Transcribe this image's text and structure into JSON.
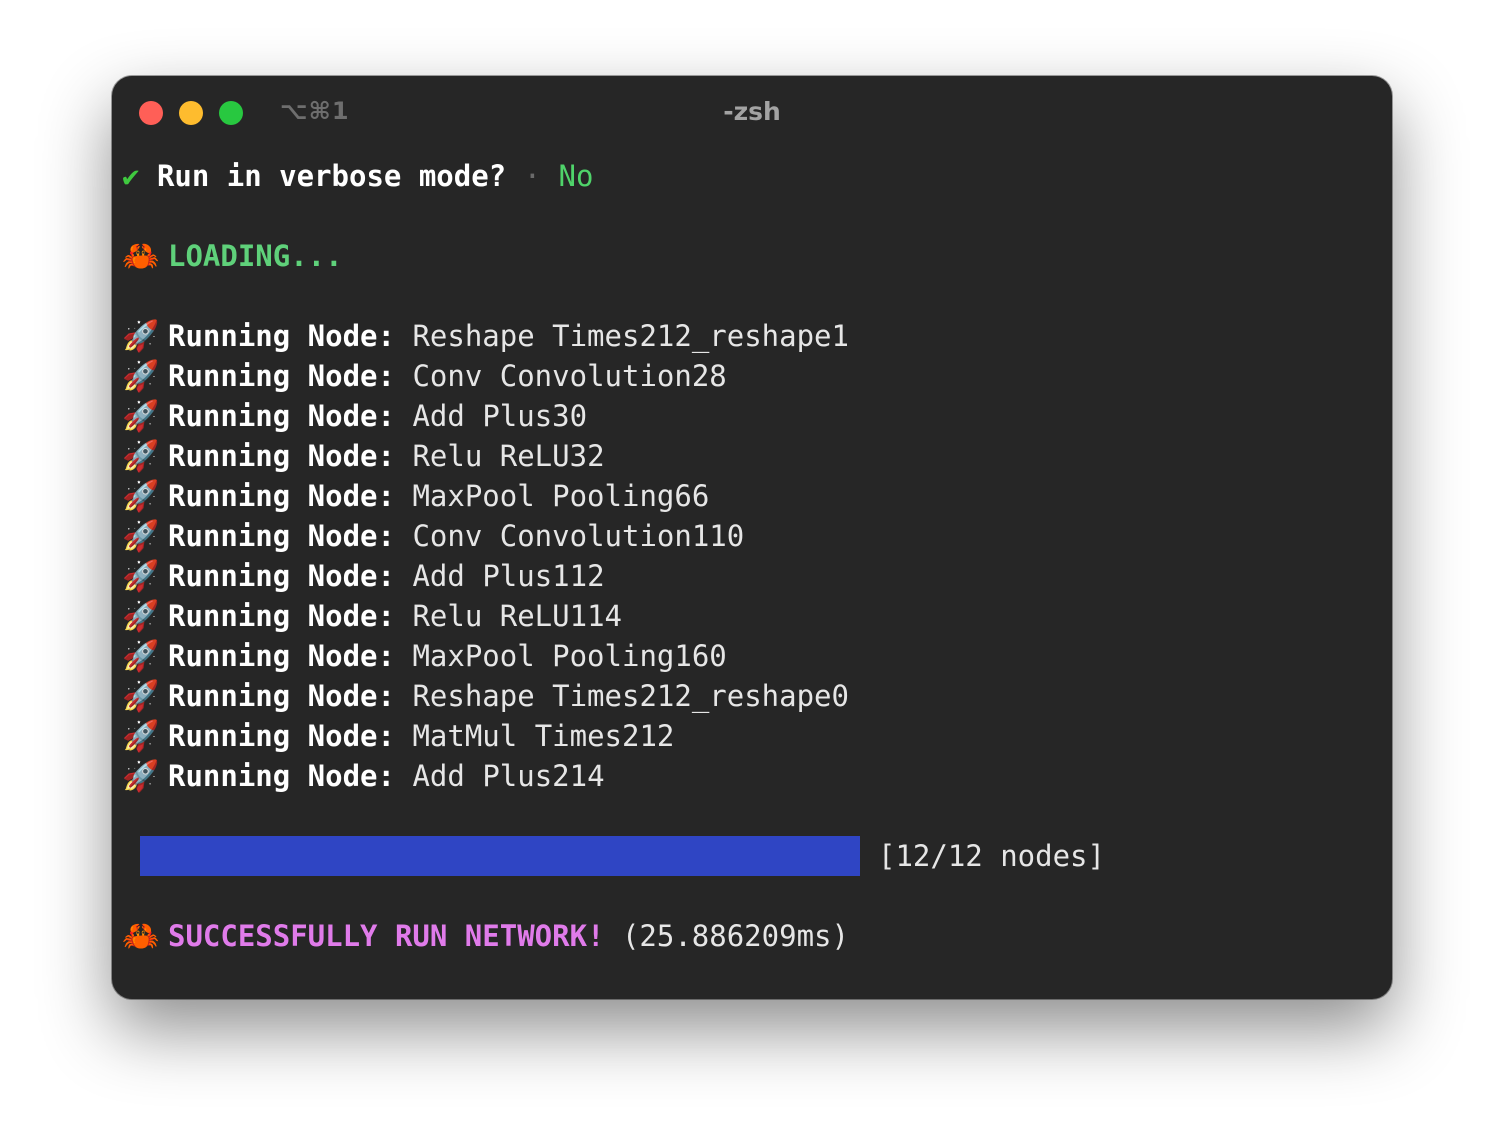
{
  "window": {
    "title": "-zsh",
    "shortcut": "⌥⌘1"
  },
  "prompt": {
    "check": "✔",
    "question": "Run in verbose mode?",
    "separator": "·",
    "answer": "No"
  },
  "loading": {
    "icon": "🦀",
    "text": "LOADING..."
  },
  "nodes": [
    {
      "icon": "🚀",
      "label": "Running Node:",
      "op": "Reshape",
      "name": "Times212_reshape1"
    },
    {
      "icon": "🚀",
      "label": "Running Node:",
      "op": "Conv",
      "name": "Convolution28"
    },
    {
      "icon": "🚀",
      "label": "Running Node:",
      "op": "Add",
      "name": "Plus30"
    },
    {
      "icon": "🚀",
      "label": "Running Node:",
      "op": "Relu",
      "name": "ReLU32"
    },
    {
      "icon": "🚀",
      "label": "Running Node:",
      "op": "MaxPool",
      "name": "Pooling66"
    },
    {
      "icon": "🚀",
      "label": "Running Node:",
      "op": "Conv",
      "name": "Convolution110"
    },
    {
      "icon": "🚀",
      "label": "Running Node:",
      "op": "Add",
      "name": "Plus112"
    },
    {
      "icon": "🚀",
      "label": "Running Node:",
      "op": "Relu",
      "name": "ReLU114"
    },
    {
      "icon": "🚀",
      "label": "Running Node:",
      "op": "MaxPool",
      "name": "Pooling160"
    },
    {
      "icon": "🚀",
      "label": "Running Node:",
      "op": "Reshape",
      "name": "Times212_reshape0"
    },
    {
      "icon": "🚀",
      "label": "Running Node:",
      "op": "MatMul",
      "name": "Times212"
    },
    {
      "icon": "🚀",
      "label": "Running Node:",
      "op": "Add",
      "name": "Plus214"
    }
  ],
  "progress": {
    "fraction": 1.0,
    "text": "[12/12 nodes]",
    "color": "#2f45c4"
  },
  "result": {
    "icon": "🦀",
    "text": "SUCCESSFULLY RUN NETWORK!",
    "timing": "(25.886209ms)"
  }
}
